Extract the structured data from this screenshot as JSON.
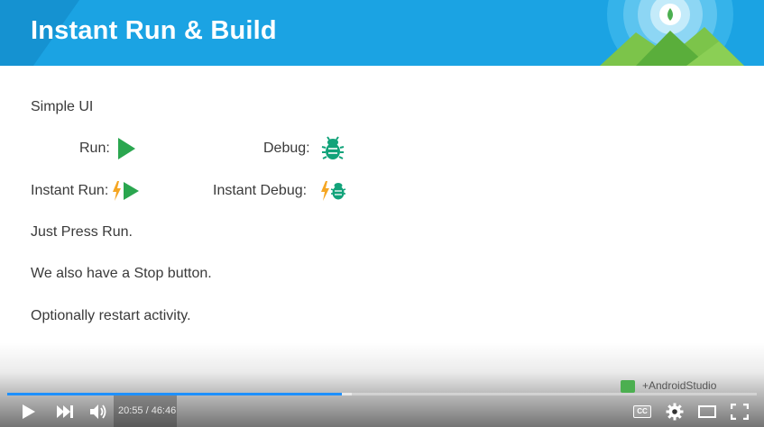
{
  "slide": {
    "title": "Instant Run & Build",
    "subtitle": "Simple UI",
    "run_label": "Run:",
    "debug_label": "Debug:",
    "instant_run_label": "Instant Run:",
    "instant_debug_label": "Instant Debug:",
    "line1": "Just Press Run.",
    "line2": "We also have a Stop button.",
    "line3": "Optionally restart activity.",
    "social_tag": "+AndroidStudio"
  },
  "icons": {
    "run": "play-triangle-icon",
    "debug": "bug-icon",
    "instant_run": "lightning-play-icon",
    "instant_debug": "lightning-bug-icon"
  },
  "player": {
    "current_time": "20:55",
    "duration": "46:46",
    "time_display": "20:55 / 46:46",
    "played_fraction": 0.447,
    "buffered_fraction": 0.46,
    "cc_label": "CC"
  },
  "colors": {
    "header_blue": "#1ba3e3",
    "android_green": "#4caf50",
    "bug_teal": "#12a37a",
    "lightning_orange": "#f5a623",
    "progress_red_blue": "#1e90ff"
  }
}
